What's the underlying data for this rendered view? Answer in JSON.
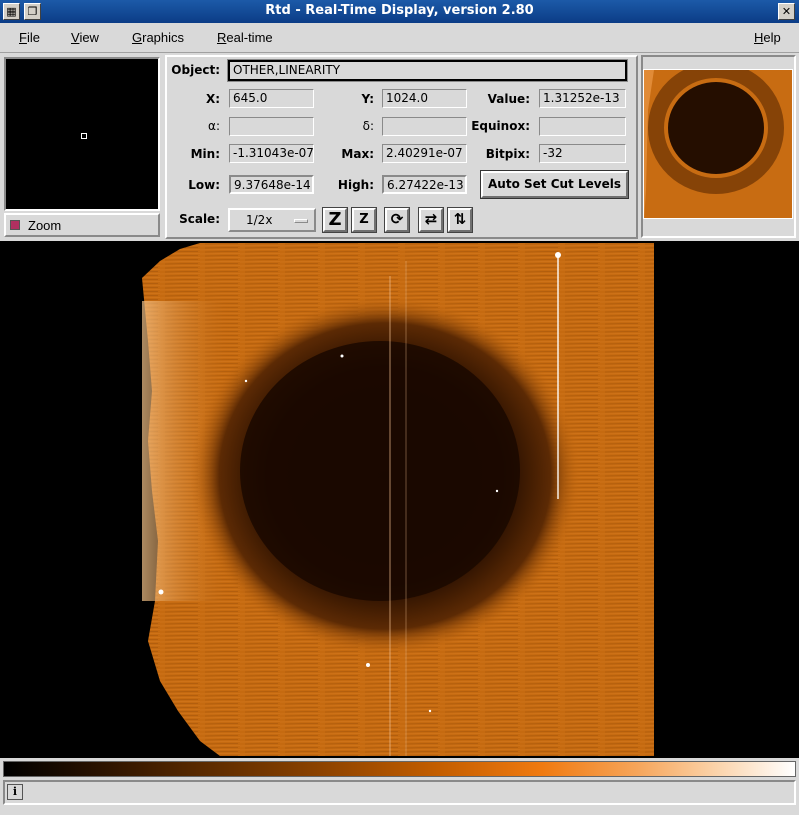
{
  "window": {
    "title": "Rtd - Real-Time Display, version 2.80"
  },
  "menubar": {
    "file": "File",
    "view": "View",
    "graphics": "Graphics",
    "realtime": "Real-time",
    "help": "Help"
  },
  "zoom": {
    "label": "Zoom"
  },
  "info": {
    "object_label": "Object:",
    "object_value": "OTHER,LINEARITY",
    "x_label": "X:",
    "x_value": "645.0",
    "y_label": "Y:",
    "y_value": "1024.0",
    "value_label": "Value:",
    "value_value": "1.31252e-13",
    "alpha_label": "α:",
    "alpha_value": "",
    "delta_label": "δ:",
    "delta_value": "",
    "equinox_label": "Equinox:",
    "equinox_value": "",
    "min_label": "Min:",
    "min_value": "-1.31043e-07",
    "max_label": "Max:",
    "max_value": "2.40291e-07",
    "bitpix_label": "Bitpix:",
    "bitpix_value": "-32",
    "low_label": "Low:",
    "low_value": "9.37648e-14",
    "high_label": "High:",
    "high_value": "6.27422e-13",
    "auto_cut_label": "Auto Set Cut Levels",
    "scale_label": "Scale:",
    "scale_value": "1/2x"
  },
  "toolbar_icons": [
    "zoom-in-icon",
    "zoom-out-icon",
    "rotate-icon",
    "flip-x-icon",
    "flip-y-icon"
  ],
  "colors": {
    "image_orange": "#c56a10",
    "image_dark": "#1a0800",
    "title_bar": "#0b3c86"
  },
  "statusbar": {
    "info_icon": "i",
    "message": ""
  }
}
